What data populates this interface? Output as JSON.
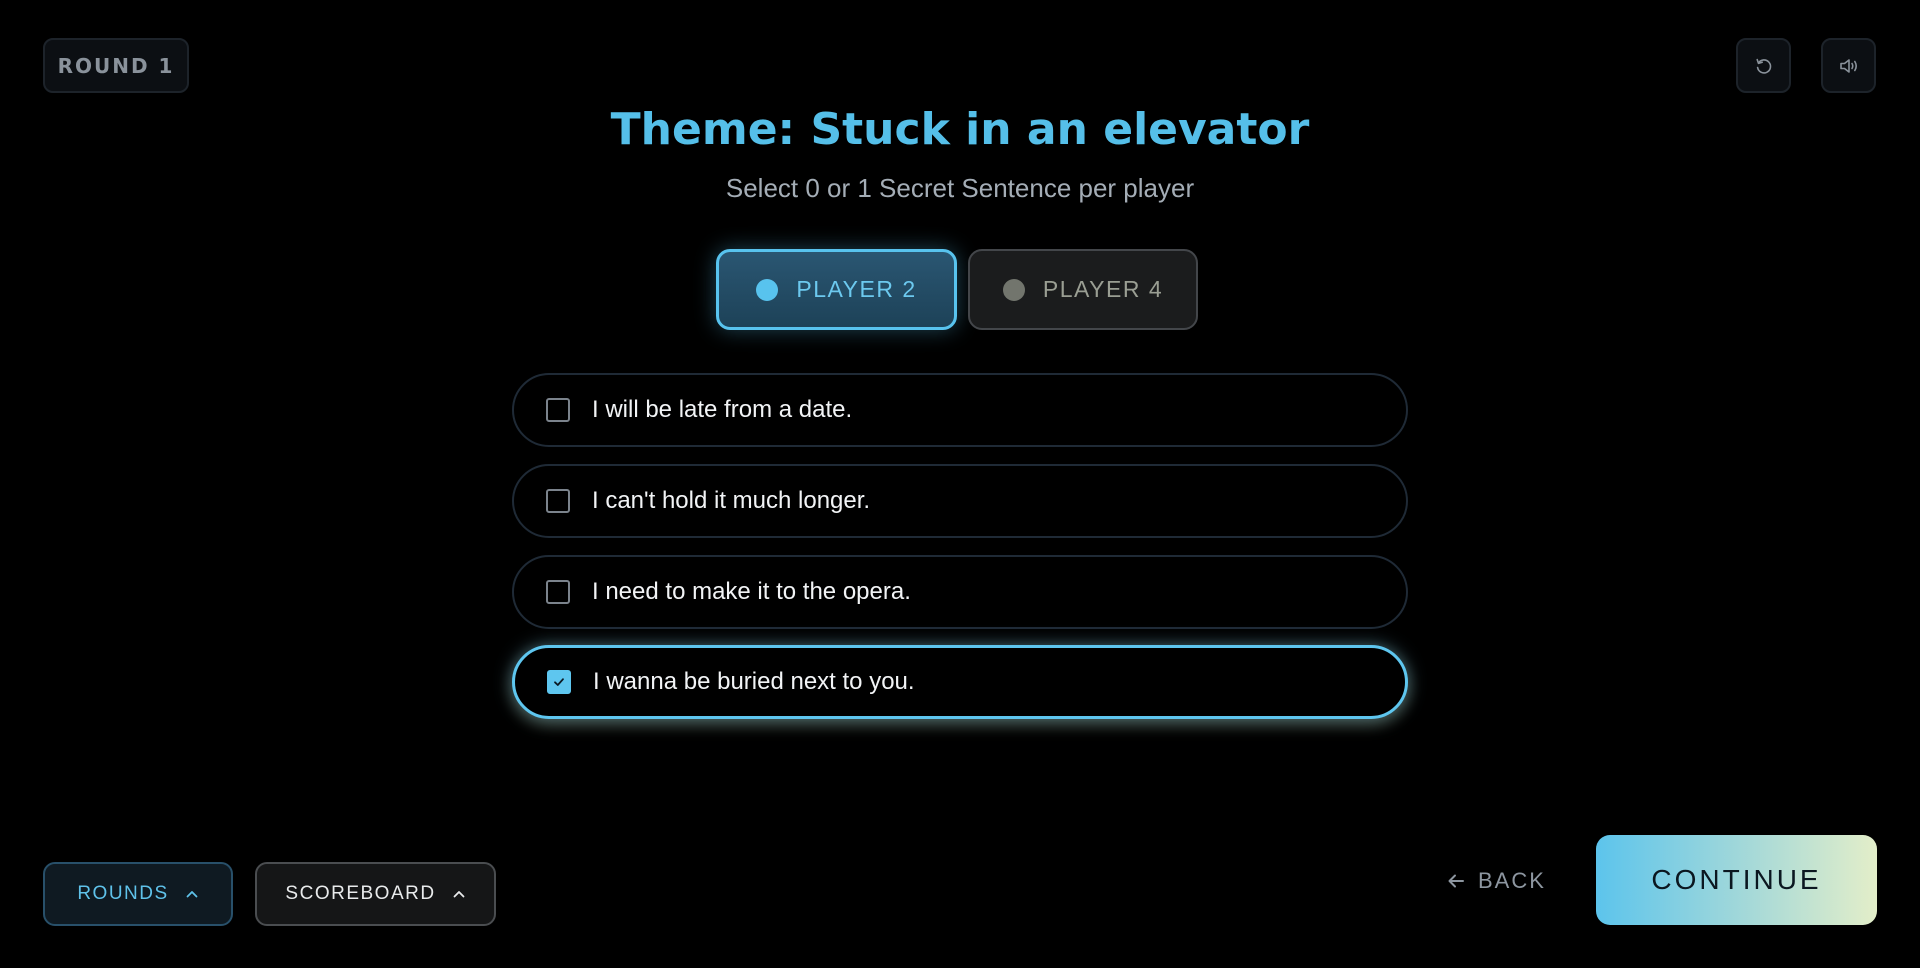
{
  "round": {
    "label": "ROUND 1"
  },
  "header": {
    "title": "Theme: Stuck in an elevator",
    "subtitle": "Select 0 or 1 Secret Sentence per player"
  },
  "icons": {
    "reset": "reset-icon",
    "sound": "speaker-icon"
  },
  "players": [
    {
      "label": "PLAYER 2",
      "active": true
    },
    {
      "label": "PLAYER 4",
      "active": false
    }
  ],
  "sentences": [
    {
      "text": "I will be late from a date.",
      "checked": false
    },
    {
      "text": "I can't hold it much longer.",
      "checked": false
    },
    {
      "text": "I need to make it to the opera.",
      "checked": false
    },
    {
      "text": "I wanna be buried next to you.",
      "checked": true
    }
  ],
  "footer": {
    "rounds_label": "ROUNDS",
    "scoreboard_label": "SCOREBOARD",
    "back_label": "BACK",
    "continue_label": "CONTINUE"
  },
  "colors": {
    "accent": "#58c3ee",
    "title": "#55bfe9",
    "background": "#000000"
  }
}
